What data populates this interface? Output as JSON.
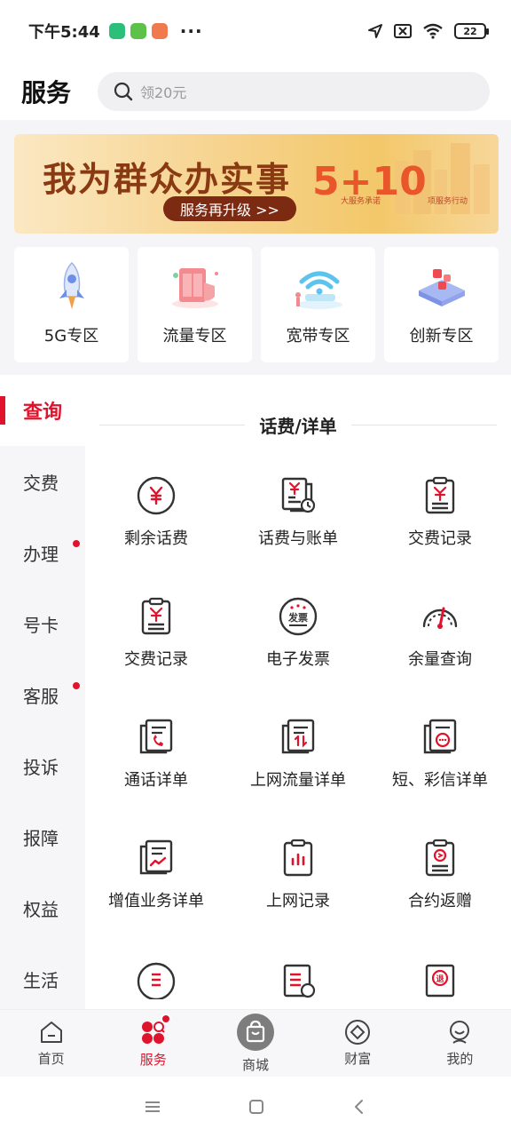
{
  "status": {
    "time": "下午5:44",
    "more": "···",
    "battery": "22"
  },
  "header": {
    "title": "服务",
    "search_placeholder": "领20元"
  },
  "banner": {
    "title": "我为群众办实事",
    "button": "服务再升级 >>",
    "numbers": "5+10",
    "sub_left": "大服务承诺",
    "sub_right": "项服务行动"
  },
  "zones": [
    {
      "label": "5G专区",
      "icon": "rocket-icon"
    },
    {
      "label": "流量专区",
      "icon": "data-box-icon"
    },
    {
      "label": "宽带专区",
      "icon": "wifi-icon"
    },
    {
      "label": "创新专区",
      "icon": "innovation-icon"
    }
  ],
  "sidebar": [
    {
      "label": "查询",
      "active": true,
      "dot": false
    },
    {
      "label": "交费",
      "active": false,
      "dot": false
    },
    {
      "label": "办理",
      "active": false,
      "dot": true
    },
    {
      "label": "号卡",
      "active": false,
      "dot": false
    },
    {
      "label": "客服",
      "active": false,
      "dot": true
    },
    {
      "label": "投诉",
      "active": false,
      "dot": false
    },
    {
      "label": "报障",
      "active": false,
      "dot": false
    },
    {
      "label": "权益",
      "active": false,
      "dot": false
    },
    {
      "label": "生活",
      "active": false,
      "dot": false
    }
  ],
  "section": {
    "title": "话费/详单"
  },
  "services": [
    {
      "label": "剩余话费",
      "icon": "yuan-circle-icon"
    },
    {
      "label": "话费与账单",
      "icon": "bill-icon"
    },
    {
      "label": "交费记录",
      "icon": "payment-record-icon"
    },
    {
      "label": "交费记录",
      "icon": "payment-record-icon"
    },
    {
      "label": "电子发票",
      "icon": "invoice-icon"
    },
    {
      "label": "余量查询",
      "icon": "gauge-icon"
    },
    {
      "label": "通话详单",
      "icon": "call-detail-icon"
    },
    {
      "label": "上网流量详单",
      "icon": "data-detail-icon"
    },
    {
      "label": "短、彩信详单",
      "icon": "sms-detail-icon"
    },
    {
      "label": "增值业务详单",
      "icon": "vas-detail-icon"
    },
    {
      "label": "上网记录",
      "icon": "browse-record-icon"
    },
    {
      "label": "合约返赠",
      "icon": "contract-icon"
    }
  ],
  "bottom_nav": [
    {
      "label": "首页",
      "icon": "home-icon",
      "active": false
    },
    {
      "label": "服务",
      "icon": "service-icon",
      "active": true,
      "badge": true
    },
    {
      "label": "商城",
      "icon": "shopping-bag-icon",
      "active": false
    },
    {
      "label": "财富",
      "icon": "diamond-icon",
      "active": false
    },
    {
      "label": "我的",
      "icon": "profile-icon",
      "active": false
    }
  ],
  "colors": {
    "accent": "#e0132c",
    "banner_text": "#8a3a12"
  }
}
